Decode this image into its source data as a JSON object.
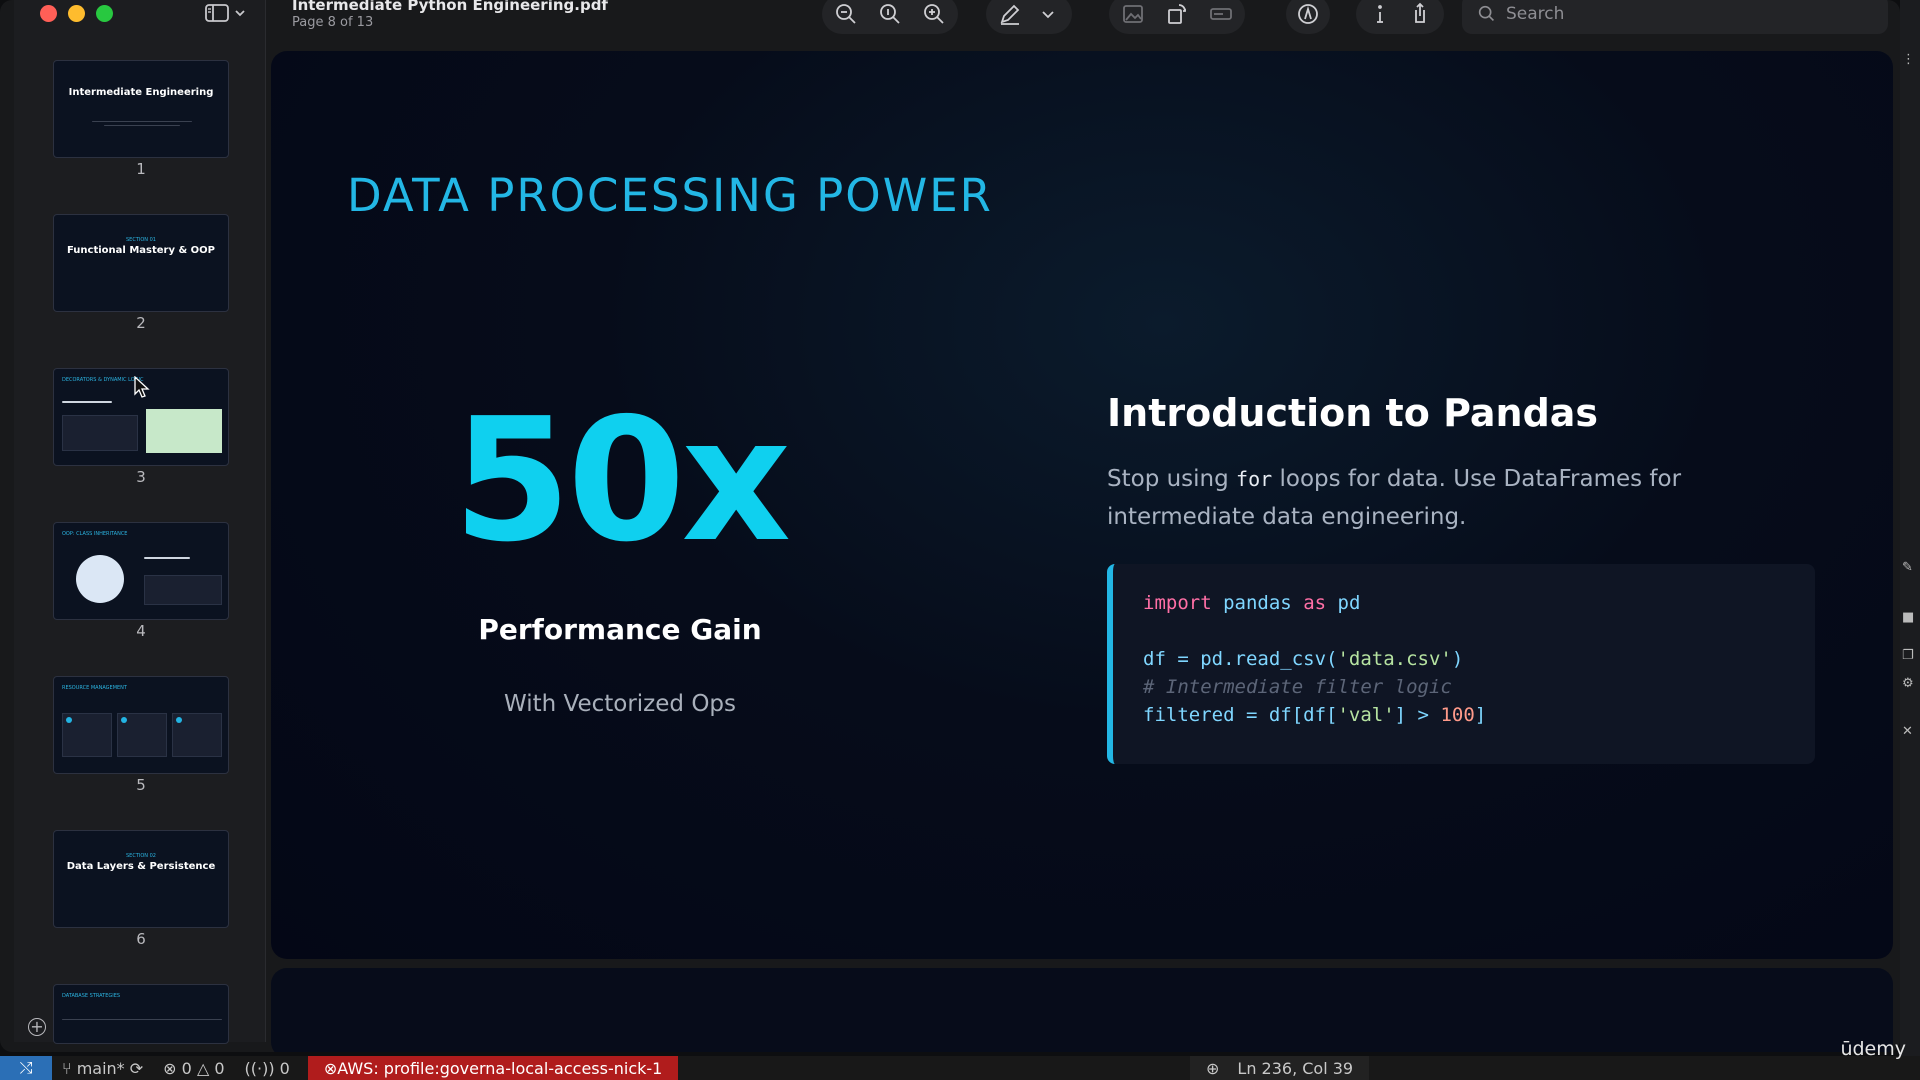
{
  "document": {
    "title": "Intermediate Python Engineering.pdf",
    "page_indicator": "Page 8 of 13"
  },
  "search": {
    "placeholder": "Search"
  },
  "thumbnails": [
    {
      "number": "1",
      "title": "Intermediate Engineering"
    },
    {
      "number": "2",
      "title": "Functional Mastery & OOP"
    },
    {
      "number": "3",
      "title": ""
    },
    {
      "number": "4",
      "title": ""
    },
    {
      "number": "5",
      "title": ""
    },
    {
      "number": "6",
      "title": "Data Layers & Persistence"
    }
  ],
  "slide": {
    "heading": "DATA PROCESSING POWER",
    "stat_value": "50x",
    "stat_title": "Performance Gain",
    "stat_subtitle": "With Vectorized Ops",
    "intro_title": "Introduction to Pandas",
    "intro_text_before": "Stop using ",
    "intro_text_code": "for",
    "intro_text_after": " loops for data. Use DataFrames for intermediate data engineering.",
    "code": {
      "line1_kw1": "import",
      "line1_mod": "pandas",
      "line1_kw2": "as",
      "line1_alias": "pd",
      "line2_start": "df = pd.read_csv(",
      "line2_str": "'data.csv'",
      "line2_end": ")",
      "line3_comment": "# Intermediate filter logic",
      "line4_start": "filtered = df[df[",
      "line4_str": "'val'",
      "line4_mid": "] > ",
      "line4_num": "100",
      "line4_end": "]"
    }
  },
  "statusbar": {
    "branch": "main*",
    "errors": "0",
    "warnings": "0",
    "ports": "0",
    "aws_profile": "AWS: profile:governa-local-access-nick-1",
    "cursor_position": "Ln 236, Col 39"
  },
  "watermark": "ūdemy",
  "colors": {
    "accent": "#23b7e5",
    "stat": "#0fd0ef",
    "aws_bg": "#b01c1c"
  }
}
